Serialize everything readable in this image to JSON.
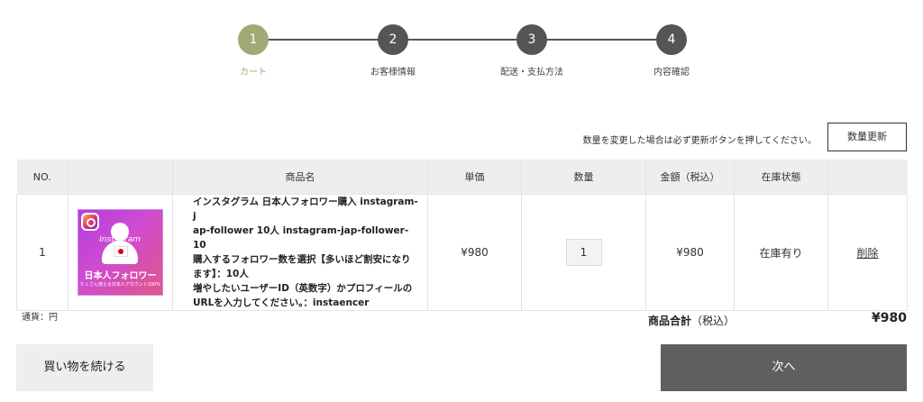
{
  "steps": [
    {
      "number": "1",
      "label": "カート",
      "active": true
    },
    {
      "number": "2",
      "label": "お客様情報",
      "active": false
    },
    {
      "number": "3",
      "label": "配送・支払方法",
      "active": false
    },
    {
      "number": "4",
      "label": "内容確認",
      "active": false
    }
  ],
  "update": {
    "note": "数量を変更した場合は必ず更新ボタンを押してください。",
    "button_label": "数量更新"
  },
  "table": {
    "headers": [
      "NO.",
      "",
      "商品名",
      "単価",
      "数量",
      "金額（税込）",
      "在庫状態",
      ""
    ],
    "rows": [
      {
        "no": "1",
        "thumbnail": {
          "ribbon": "Instagram",
          "caption": "日本人フォロワー",
          "small_caption": "たくさん増える日本人アカウント100%"
        },
        "name_lines": [
          "インスタグラム 日本人フォロワー購入 instagram-j",
          "ap-follower 10人 instagram-jap-follower-10",
          "購入するフォロワー数を選択【多いほど割安になり",
          "ます】：10人",
          "増やしたいユーザーID（英数字）かプロフィールの",
          "URLを入力してください。：instaencer"
        ],
        "unit_price": "¥980",
        "quantity": "1",
        "amount": "¥980",
        "stock": "在庫有り",
        "delete_label": "削除"
      }
    ]
  },
  "currency_note": "通貨：円",
  "subtotal": {
    "label": "商品合計",
    "tax_label": "（税込）",
    "value": "¥980"
  },
  "buttons": {
    "continue": "買い物を続ける",
    "next": "次へ"
  },
  "colors": {
    "active_step": "#a2a974",
    "inactive_step": "#555555",
    "next_button": "#5f5f5f"
  }
}
